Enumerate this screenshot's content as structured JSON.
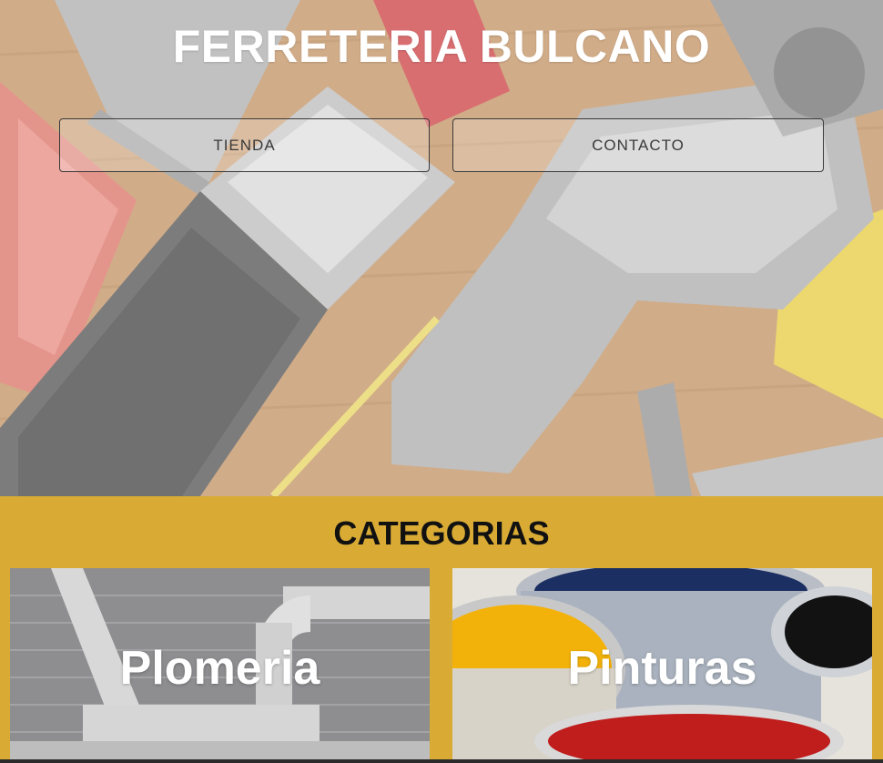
{
  "header": {
    "title": "FERRETERIA BULCANO"
  },
  "nav": {
    "items": [
      {
        "label": "TIENDA"
      },
      {
        "label": "CONTACTO"
      }
    ]
  },
  "categories": {
    "title": "CATEGORIAS",
    "items": [
      {
        "label": "Plomeria",
        "image": "plumbing-pipes-photo"
      },
      {
        "label": "Pinturas",
        "image": "paint-cans-photo"
      }
    ]
  },
  "hero": {
    "image": "hand-tools-photo"
  },
  "colors": {
    "accent": "#d9ab35",
    "title_text": "#ffffff",
    "nav_text": "#3a3a3a",
    "section_title": "#111111"
  }
}
